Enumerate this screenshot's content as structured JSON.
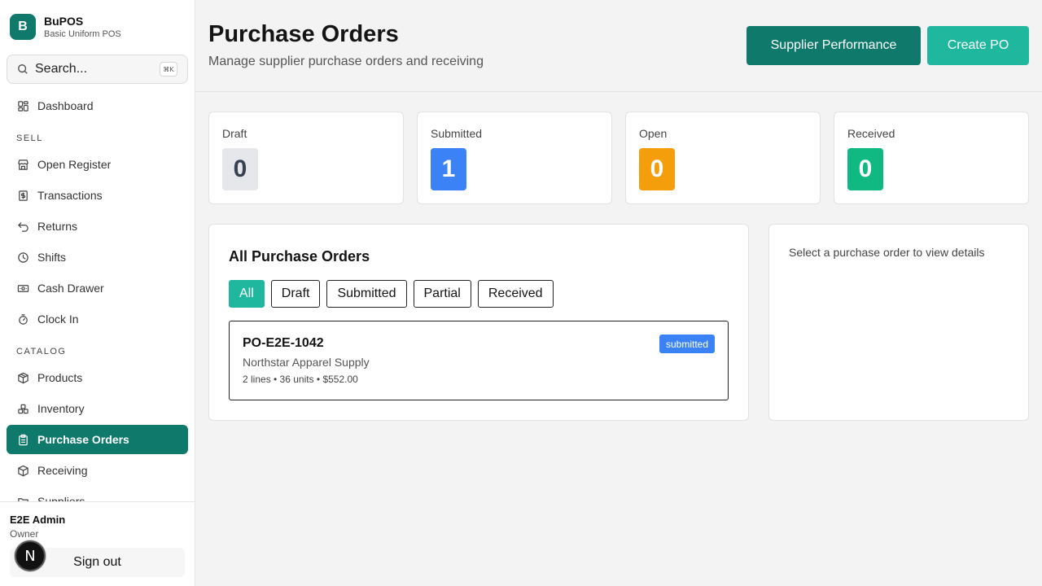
{
  "brand": {
    "logo_letter": "B",
    "name": "BuPOS",
    "subtitle": "Basic Uniform POS"
  },
  "search": {
    "placeholder": "Search...",
    "shortcut": "⌘K"
  },
  "sidebar": {
    "items": [
      {
        "label": "Dashboard",
        "icon": "dashboard-icon"
      },
      {
        "section": "SELL"
      },
      {
        "label": "Open Register",
        "icon": "store-icon"
      },
      {
        "label": "Transactions",
        "icon": "receipt-icon"
      },
      {
        "label": "Returns",
        "icon": "undo-icon"
      },
      {
        "label": "Shifts",
        "icon": "clock-icon"
      },
      {
        "label": "Cash Drawer",
        "icon": "banknote-icon"
      },
      {
        "label": "Clock In",
        "icon": "timer-icon"
      },
      {
        "section": "CATALOG"
      },
      {
        "label": "Products",
        "icon": "package-icon"
      },
      {
        "label": "Inventory",
        "icon": "boxes-icon"
      },
      {
        "label": "Purchase Orders",
        "icon": "clipboard-icon",
        "active": true
      },
      {
        "label": "Receiving",
        "icon": "package-check-icon"
      },
      {
        "label": "Suppliers",
        "icon": "folder-icon"
      }
    ]
  },
  "user": {
    "name": "E2E Admin",
    "role": "Owner",
    "signout_label": "Sign out",
    "badge_letter": "N"
  },
  "header": {
    "title": "Purchase Orders",
    "subtitle": "Manage supplier purchase orders and receiving",
    "supplier_performance_label": "Supplier Performance",
    "create_po_label": "Create PO"
  },
  "stats": [
    {
      "label": "Draft",
      "value": "0",
      "bg": "#e5e7eb",
      "fg": "#374151"
    },
    {
      "label": "Submitted",
      "value": "1",
      "bg": "#3b82f6",
      "fg": "#ffffff"
    },
    {
      "label": "Open",
      "value": "0",
      "bg": "#f59e0b",
      "fg": "#ffffff"
    },
    {
      "label": "Received",
      "value": "0",
      "bg": "#10b981",
      "fg": "#ffffff"
    }
  ],
  "list": {
    "title": "All Purchase Orders",
    "filters": [
      "All",
      "Draft",
      "Submitted",
      "Partial",
      "Received"
    ],
    "active_filter": "All",
    "orders": [
      {
        "id": "PO-E2E-1042",
        "supplier": "Northstar Apparel Supply",
        "meta": "2 lines • 36 units • $552.00",
        "status": "submitted"
      }
    ]
  },
  "detail": {
    "empty_text": "Select a purchase order to view details"
  },
  "colors": {
    "brand": "#0f7a6c",
    "accent": "#1fb89f",
    "status_submitted": "#3b82f6"
  }
}
